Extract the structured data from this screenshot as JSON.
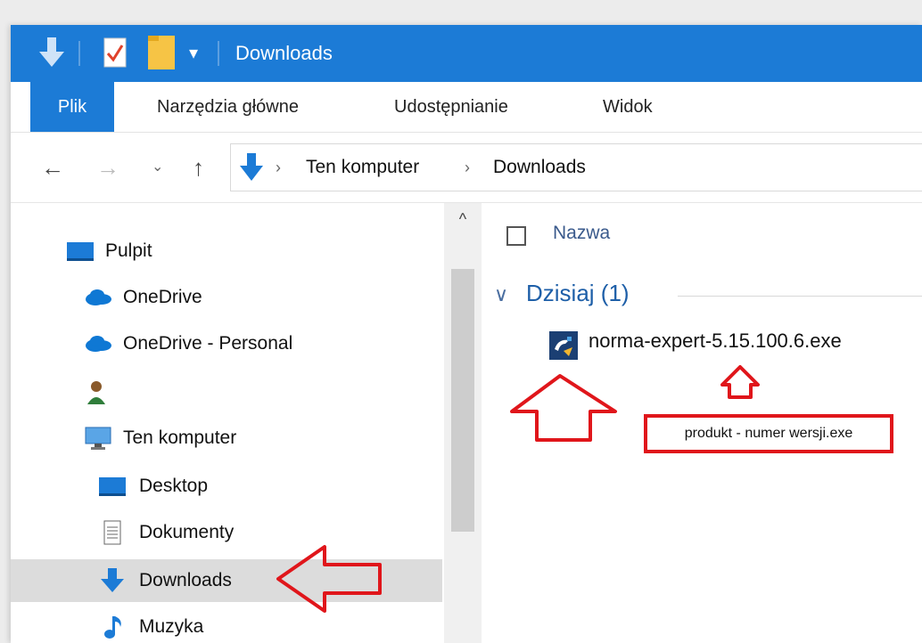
{
  "window": {
    "title": "Downloads",
    "quick_access_icons": [
      "download-arrow-icon",
      "properties-icon",
      "new-folder-icon",
      "customize-dropdown-icon"
    ]
  },
  "ribbon": {
    "tabs": [
      {
        "label": "Plik",
        "active": true
      },
      {
        "label": "Narzędzia główne",
        "active": false
      },
      {
        "label": "Udostępnianie",
        "active": false
      },
      {
        "label": "Widok",
        "active": false
      }
    ]
  },
  "navigation": {
    "back_icon": "back-arrow-icon",
    "forward_icon": "forward-arrow-icon",
    "recent_icon": "chevron-down-icon",
    "up_icon": "up-arrow-icon",
    "breadcrumb": [
      "Ten komputer",
      "Downloads"
    ],
    "separator": "›"
  },
  "sidebar": {
    "items": [
      {
        "label": "Pulpit",
        "icon": "desktop-icon",
        "selected": false
      },
      {
        "label": "OneDrive",
        "icon": "cloud-icon",
        "selected": false
      },
      {
        "label": "OneDrive - Personal",
        "icon": "cloud-icon",
        "selected": false
      },
      {
        "label": "",
        "icon": "user-icon",
        "selected": false
      },
      {
        "label": "Ten komputer",
        "icon": "computer-icon",
        "selected": false
      },
      {
        "label": "Desktop",
        "icon": "desktop-icon",
        "selected": false
      },
      {
        "label": "Dokumenty",
        "icon": "document-icon",
        "selected": false
      },
      {
        "label": "Downloads",
        "icon": "download-arrow-icon",
        "selected": true
      },
      {
        "label": "Muzyka",
        "icon": "music-note-icon",
        "selected": false
      }
    ]
  },
  "content": {
    "column_header": "Nazwa",
    "group": "Dzisiaj (1)",
    "files": [
      {
        "name": "norma-expert-5.15.100.6.exe",
        "icon": "installer-icon"
      }
    ]
  },
  "annotation": {
    "label": "produkt - numer wersji.exe",
    "color": "#e0161b"
  },
  "colors": {
    "accent": "#1c7bd6",
    "selected_bg": "#dcdcdc",
    "group_text": "#1e5fa8"
  }
}
